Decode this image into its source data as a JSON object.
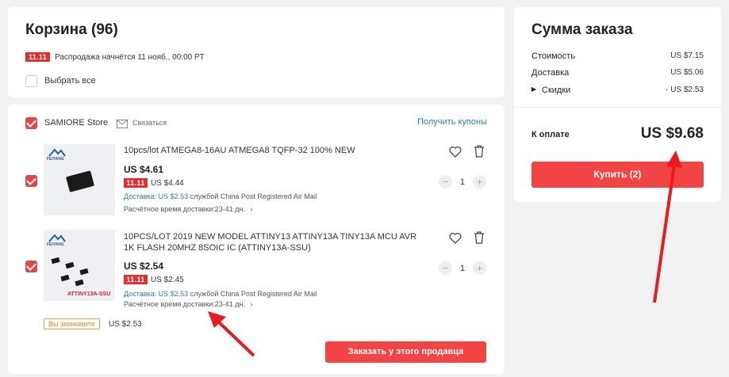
{
  "header": {
    "cart_title": "Корзина (96)",
    "sale_badge": "11.11",
    "sale_text": "Распродажа начнётся 11 нояб., 00:00 PT",
    "select_all_label": "Выбрать все"
  },
  "store": {
    "name": "SAMIORE Store",
    "contact_label": "Связаться",
    "coupons_label": "Получить купоны",
    "items": [
      {
        "title": "10pcs/lot ATMEGA8-16AU ATMEGA8 TQFP-32 100% NEW",
        "price": "US $4.61",
        "sale_badge": "11.11",
        "sale_price": "US $4.44",
        "shipping_cost": "Доставка: US $2.53",
        "shipping_method": "службой China Post Registered Air Mail",
        "delivery_time": "Расчётное время доставки:23-41 дн.",
        "quantity": "1",
        "brand": "FEIYANG"
      },
      {
        "title_line1": "10PCS/LOT 2019 NEW MODEL ATTINY13 ATTINY13A TINY13A MCU AVR",
        "title_line2": "1K FLASH 20MHZ 8SOIC IC (ATTINY13A-SSU)",
        "price": "US $2.54",
        "sale_badge": "11.11",
        "sale_price": "US $2.45",
        "shipping_cost": "Доставка: US $2.53",
        "shipping_method": "службой China Post Registered Air Mail",
        "delivery_time": "Расчётное время доставки:23-41 дн.",
        "quantity": "1",
        "brand": "FEIYANG",
        "image_label": "ATTINY13A-SSU"
      }
    ],
    "savings_badge": "Вы экономите",
    "savings_value": "US $2.53",
    "order_button": "Заказать у этого продавца"
  },
  "summary": {
    "title": "Сумма заказа",
    "rows": [
      {
        "label": "Стоимость",
        "value": "US $7.15"
      },
      {
        "label": "Доставка",
        "value": "US $5.06"
      },
      {
        "label": "Скидки",
        "value": "- US $2.53"
      }
    ],
    "total_label": "К оплате",
    "total_value": "US $9.68",
    "buy_button": "Купить (2)"
  },
  "colors": {
    "accent_red": "#f24444",
    "link_blue": "#2a7ab0",
    "arrow_red": "#e81c1c"
  }
}
